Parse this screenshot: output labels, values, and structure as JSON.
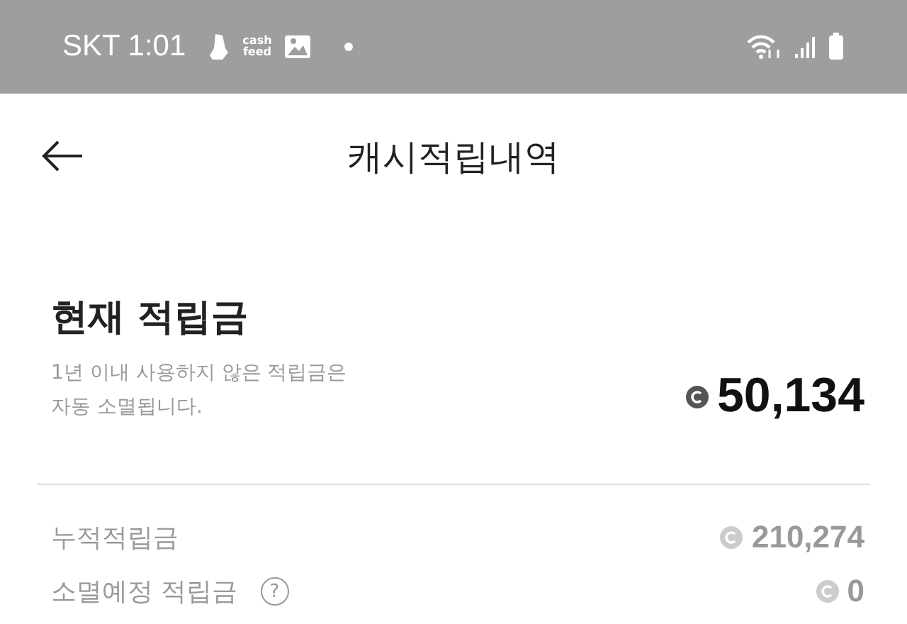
{
  "status_bar": {
    "carrier": "SKT",
    "time": "1:01",
    "app_badge": "cash\nfeed"
  },
  "header": {
    "title": "캐시적립내역"
  },
  "current": {
    "title": "현재 적립금",
    "note": "1년 이내 사용하지 않은 적립금은\n자동 소멸됩니다.",
    "amount": "50,134"
  },
  "rows": [
    {
      "label": "누적적립금",
      "amount": "210,274",
      "help": false
    },
    {
      "label": "소멸예정 적립금",
      "amount": "0",
      "help": true,
      "help_mark": "?"
    }
  ]
}
